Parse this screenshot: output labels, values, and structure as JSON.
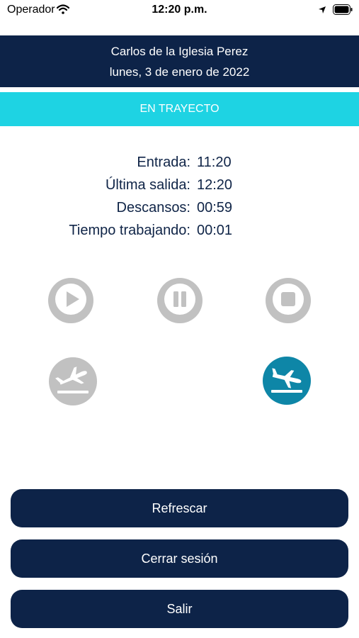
{
  "status_bar": {
    "carrier": "Operador",
    "time": "12:20 p.m."
  },
  "header": {
    "employee_name": "Carlos de la Iglesia Perez",
    "date": "lunes, 3 de enero de 2022"
  },
  "status": {
    "label": "EN TRAYECTO",
    "color": "#1ed3e3"
  },
  "times": [
    {
      "label": "Entrada:",
      "value": "11:20"
    },
    {
      "label": "Última salida:",
      "value": "12:20"
    },
    {
      "label": "Descansos:",
      "value": "00:59"
    },
    {
      "label": "Tiempo trabajando:",
      "value": "00:01"
    }
  ],
  "controls": {
    "play_icon": "play-icon",
    "pause_icon": "pause-icon",
    "stop_icon": "stop-icon",
    "departure_icon": "airplane-departure-icon",
    "arrival_icon": "airplane-arrival-icon",
    "disabled_color": "#c1c1c1",
    "active_color": "#0e86a7"
  },
  "buttons": {
    "refresh": "Refrescar",
    "logout": "Cerrar sesión",
    "exit": "Salir"
  },
  "colors": {
    "navy": "#0d2348",
    "accent": "#1ed3e3"
  }
}
